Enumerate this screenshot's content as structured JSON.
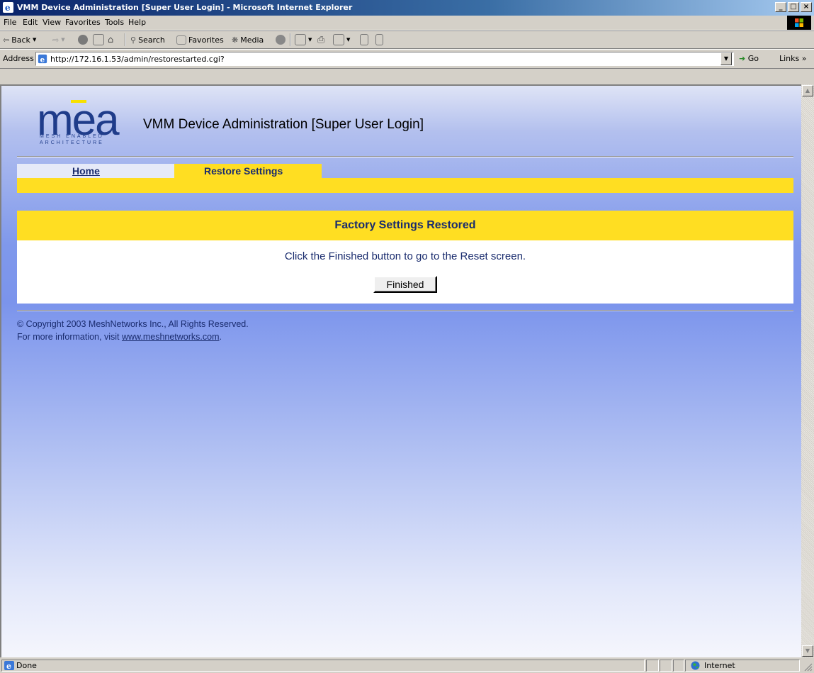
{
  "window": {
    "title": "VMM Device Administration [Super User Login] - Microsoft Internet Explorer",
    "min_label": "_",
    "max_label": "□",
    "close_label": "×"
  },
  "menu": [
    "File",
    "Edit",
    "View",
    "Favorites",
    "Tools",
    "Help"
  ],
  "toolbar": {
    "back": "Back",
    "search": "Search",
    "favorites": "Favorites",
    "media": "Media"
  },
  "address": {
    "label": "Address",
    "url": "http://172.16.1.53/admin/restorestarted.cgi?",
    "go": "Go",
    "links": "Links »"
  },
  "logo": {
    "text": "mea",
    "line1": "MESH ENABLED",
    "line2": "ARCHITECTURE"
  },
  "page": {
    "title": "VMM Device Administration [Super User Login]",
    "tabs": {
      "home": "Home",
      "restore": "Restore Settings"
    },
    "panel_heading": "Factory Settings Restored",
    "message": "Click the Finished button to go to the Reset screen.",
    "finish_button": "Finished",
    "copyright": "© Copyright 2003 MeshNetworks Inc., All Rights Reserved.",
    "more_info_prefix": "For more information, visit ",
    "more_info_link": "www.meshnetworks.com",
    "more_info_suffix": "."
  },
  "status": {
    "left": "Done",
    "zone": "Internet"
  },
  "colors": {
    "accent_yellow": "#ffde22",
    "brand_navy": "#1a2c6e",
    "title_blue": "#0a246a"
  }
}
